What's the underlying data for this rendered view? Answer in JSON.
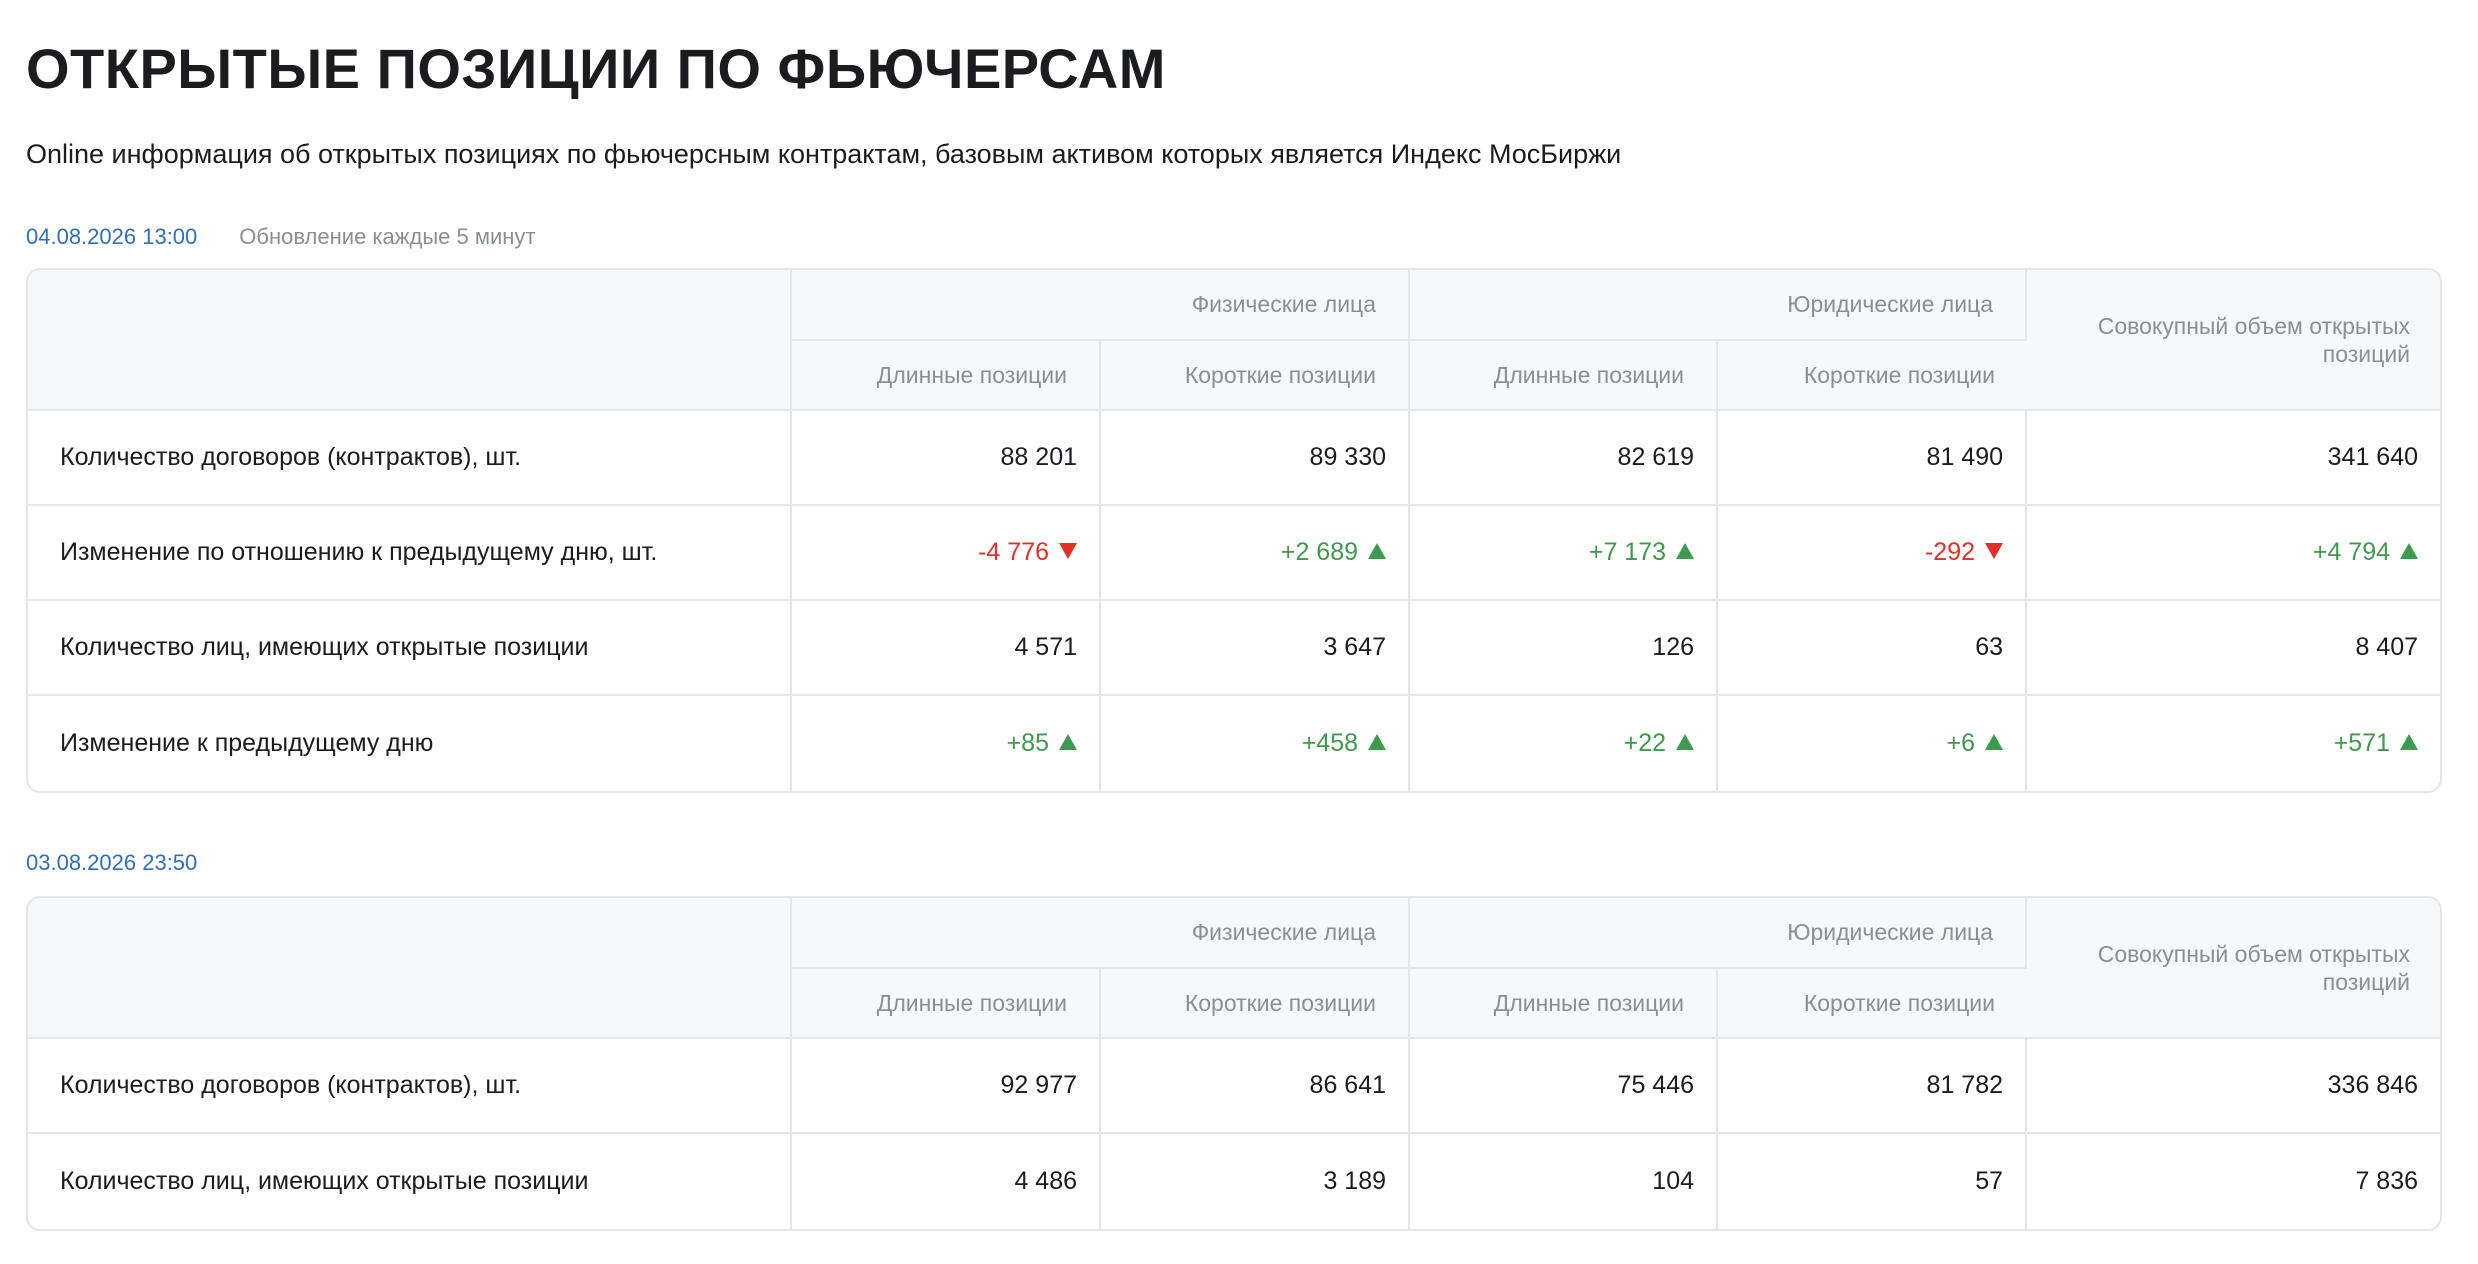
{
  "page": {
    "title": "ОТКРЫТЫЕ ПОЗИЦИИ ПО ФЬЮЧЕРСАМ",
    "subtitle": "Online информация об открытых позициях по фьючерсным контрактам, базовым активом которых является Индекс МосБиржи"
  },
  "header": {
    "group_physical": "Физические лица",
    "group_legal": "Юридические лица",
    "long": "Длинные позиции",
    "short": "Короткие позиции",
    "total": "Совокупный объем открытых позиций"
  },
  "colors": {
    "negative": "#e03126",
    "positive": "#3f9a4e",
    "link": "#2f6fc0"
  },
  "block1": {
    "timestamp": "04.08.2026 13:00",
    "update_note": "Обновление каждые 5 минут",
    "rows": [
      {
        "label": "Количество договоров (контрактов), шт.",
        "cells": [
          "88 201",
          "89 330",
          "82 619",
          "81 490",
          "341 640"
        ]
      },
      {
        "label": "Изменение по отношению к предыдущему дню, шт.",
        "cells": [
          "-4 776",
          "+2 689",
          "+7 173",
          "-292",
          "+4 794"
        ],
        "dirs": [
          "down",
          "up",
          "up",
          "down",
          "up"
        ]
      },
      {
        "label": "Количество лиц, имеющих открытые позиции",
        "cells": [
          "4 571",
          "3 647",
          "126",
          "63",
          "8 407"
        ]
      },
      {
        "label": "Изменение к предыдущему дню",
        "cells": [
          "+85",
          "+458",
          "+22",
          "+6",
          "+571"
        ],
        "dirs": [
          "up",
          "up",
          "up",
          "up",
          "up"
        ]
      }
    ]
  },
  "block2": {
    "timestamp": "03.08.2026 23:50",
    "rows": [
      {
        "label": "Количество договоров (контрактов), шт.",
        "cells": [
          "92 977",
          "86 641",
          "75 446",
          "81 782",
          "336 846"
        ]
      },
      {
        "label": "Количество лиц, имеющих открытые позиции",
        "cells": [
          "4 486",
          "3 189",
          "104",
          "57",
          "7 836"
        ]
      }
    ]
  }
}
